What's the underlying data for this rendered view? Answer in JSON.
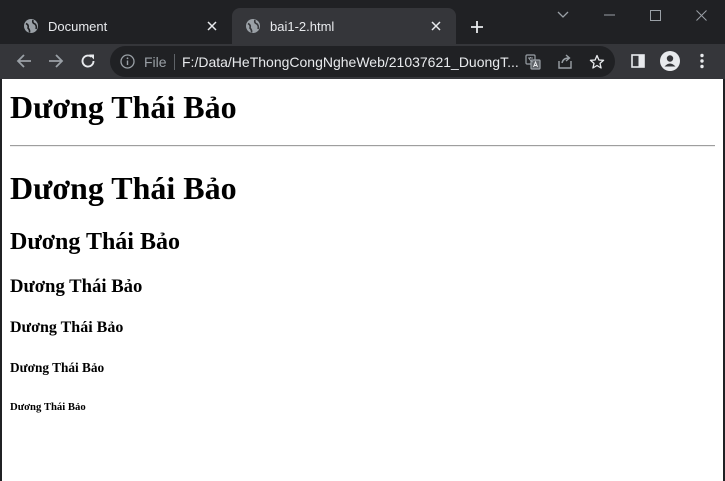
{
  "browser": {
    "tabs": [
      {
        "title": "Document",
        "icon": "globe-icon",
        "active": false
      },
      {
        "title": "bai1-2.html",
        "icon": "globe-icon",
        "active": true
      }
    ],
    "address": {
      "scheme_label": "File",
      "url": "F:/Data/HeThongCongNgheWeb/21037621_DuongT..."
    },
    "colors": {
      "frame": "#202124",
      "toolbar": "#35363a",
      "text": "#e8eaed",
      "page": "#ffffff"
    }
  },
  "page": {
    "heading_top": "Dương Thái Bảo",
    "headings": [
      {
        "level": "h1",
        "text": "Dương Thái Bảo"
      },
      {
        "level": "h2",
        "text": "Dương Thái Bảo"
      },
      {
        "level": "h3",
        "text": "Dương Thái Bảo"
      },
      {
        "level": "h4",
        "text": "Dương Thái Bảo"
      },
      {
        "level": "h5",
        "text": "Dương Thái Bảo"
      },
      {
        "level": "h6",
        "text": "Dương Thái Bảo"
      }
    ]
  }
}
